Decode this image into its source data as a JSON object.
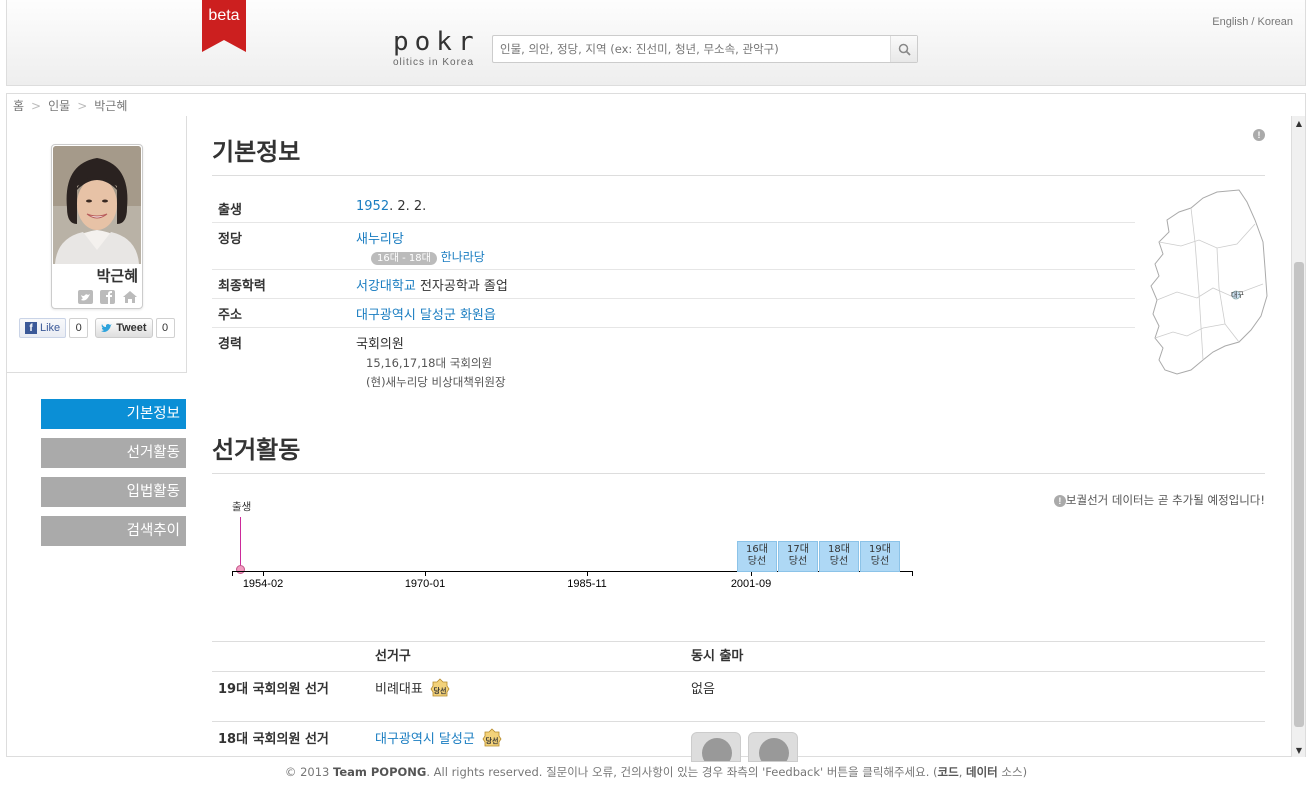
{
  "header": {
    "beta_label": "beta",
    "logo_main": "pokr",
    "logo_sub": "olitics in Korea",
    "search_placeholder": "인물, 의안, 정당, 지역 (ex: 진선미, 청년, 무소속, 관악구)",
    "lang_english": "English",
    "lang_separator": " / ",
    "lang_korean": "Korean"
  },
  "breadcrumb": [
    "홈",
    "인물",
    "박근혜"
  ],
  "breadcrumb_sep": ">",
  "profile": {
    "name": "박근혜",
    "fb_like_label": "Like",
    "fb_like_count": "0",
    "tweet_label": "Tweet",
    "tweet_count": "0"
  },
  "sidenav": [
    {
      "label": "기본정보",
      "active": true
    },
    {
      "label": "선거활동",
      "active": false
    },
    {
      "label": "입법활동",
      "active": false
    },
    {
      "label": "검색추이",
      "active": false
    }
  ],
  "basic_info": {
    "title": "기본정보",
    "rows": {
      "birth": {
        "label": "출생",
        "year": "1952",
        "rest": ". 2. 2."
      },
      "party": {
        "label": "정당",
        "current": "새누리당",
        "badge": "16대 - 18대",
        "past": "한나라당"
      },
      "education": {
        "label": "최종학력",
        "school": "서강대학교",
        "rest": " 전자공학과 졸업"
      },
      "address": {
        "label": "주소",
        "value": "대구광역시 달성군 화원읍"
      },
      "career": {
        "label": "경력",
        "main": "국회의원",
        "sub1": "15,16,17,18대 국회의원",
        "sub2": "(현)새누리당 비상대책위원장"
      }
    },
    "map_marker": "대구"
  },
  "election": {
    "title": "선거활동",
    "note": "보궐선거 데이터는 곧 추가될 예정입니다!",
    "birth_label": "출생",
    "axis_labels": [
      "1954-02",
      "1970-01",
      "1985-11",
      "2001-09"
    ],
    "boxes": [
      {
        "line1": "16대",
        "line2": "당선"
      },
      {
        "line1": "17대",
        "line2": "당선"
      },
      {
        "line1": "18대",
        "line2": "당선"
      },
      {
        "line1": "19대",
        "line2": "당선"
      }
    ],
    "table_headers": {
      "district": "선거구",
      "concurrent": "동시 출마"
    },
    "rows": [
      {
        "name": "19대 국회의원 선거",
        "district": "비례대표",
        "district_link": false,
        "concurrent": "없음"
      },
      {
        "name": "18대 국회의원 선거",
        "district": "대구광역시 달성군",
        "district_link": true,
        "concurrent": ""
      }
    ],
    "win_badge": "당선"
  },
  "footer": {
    "prefix": "© 2013 ",
    "team": "Team POPONG",
    "text": ". All rights reserved. 질문이나 오류, 건의사항이 있는 경우 좌측의 'Feedback' 버튼을 클릭해주세요. (",
    "code": "코드",
    "comma": ", ",
    "data": "데이터",
    "suffix": " 소스)"
  },
  "colors": {
    "accent": "#0b8fd6",
    "link": "#1a7dc1",
    "beta_ribbon": "#cc1f1f",
    "timeline_box": "#aed8f5"
  }
}
